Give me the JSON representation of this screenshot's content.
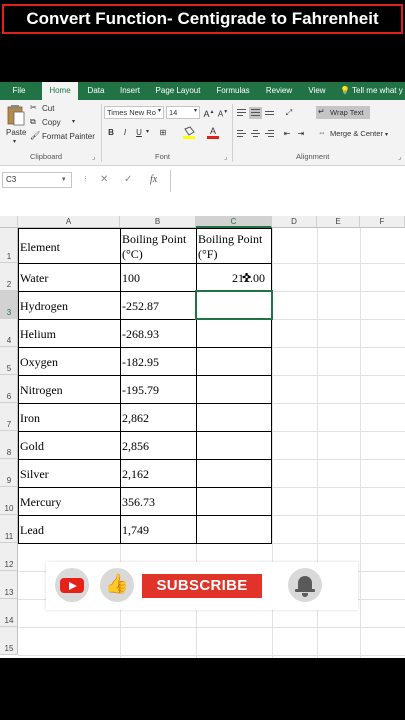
{
  "banner": {
    "title": "Convert Function- Centigrade to Fahrenheit"
  },
  "ribbon": {
    "tabs": [
      "File",
      "Home",
      "Data",
      "Insert",
      "Page Layout",
      "Formulas",
      "Review",
      "View"
    ],
    "active_tab": "Home",
    "tell_me": "Tell me what y",
    "clipboard": {
      "paste": "Paste",
      "cut": "Cut",
      "copy": "Copy",
      "format_painter": "Format Painter",
      "label": "Clipboard"
    },
    "font": {
      "name": "Times New Ro",
      "size": "14",
      "bold": "B",
      "italic": "I",
      "underline": "U",
      "label": "Font"
    },
    "alignment": {
      "wrap_text": "Wrap Text",
      "merge_center": "Merge & Center",
      "label": "Alignment"
    }
  },
  "formula_bar": {
    "name_box": "C3",
    "cancel": "✕",
    "enter": "✓",
    "fx": "fx",
    "value": ""
  },
  "grid": {
    "columns": [
      "A",
      "B",
      "C",
      "D",
      "E",
      "F"
    ],
    "rows": [
      "1",
      "2",
      "3",
      "4",
      "5",
      "6",
      "7",
      "8",
      "9",
      "10",
      "11",
      "12",
      "13",
      "14",
      "15"
    ],
    "selected_cell": "C3",
    "header_row": {
      "element": "Element",
      "boiling_c_1": "Boiling Point",
      "boiling_c_2": "(°C)",
      "boiling_f_1": "Boiling Point",
      "boiling_f_2": "(°F)"
    },
    "data_rows": [
      {
        "element": "Water",
        "celsius": "100",
        "fahrenheit": "212.00"
      },
      {
        "element": "Hydrogen",
        "celsius": "-252.87",
        "fahrenheit": ""
      },
      {
        "element": "Helium",
        "celsius": "-268.93",
        "fahrenheit": ""
      },
      {
        "element": "Oxygen",
        "celsius": "-182.95",
        "fahrenheit": ""
      },
      {
        "element": "Nitrogen",
        "celsius": "-195.79",
        "fahrenheit": ""
      },
      {
        "element": "Iron",
        "celsius": "2,862",
        "fahrenheit": ""
      },
      {
        "element": "Gold",
        "celsius": "2,856",
        "fahrenheit": ""
      },
      {
        "element": "Silver",
        "celsius": "2,162",
        "fahrenheit": ""
      },
      {
        "element": "Mercury",
        "celsius": "356.73",
        "fahrenheit": ""
      },
      {
        "element": "Lead",
        "celsius": "1,749",
        "fahrenheit": ""
      }
    ]
  },
  "overlay": {
    "subscribe": "SUBSCRIBE"
  },
  "colors": {
    "excel_green": "#217346",
    "banner_border": "#e0201b",
    "subscribe_red": "#e0342a"
  }
}
